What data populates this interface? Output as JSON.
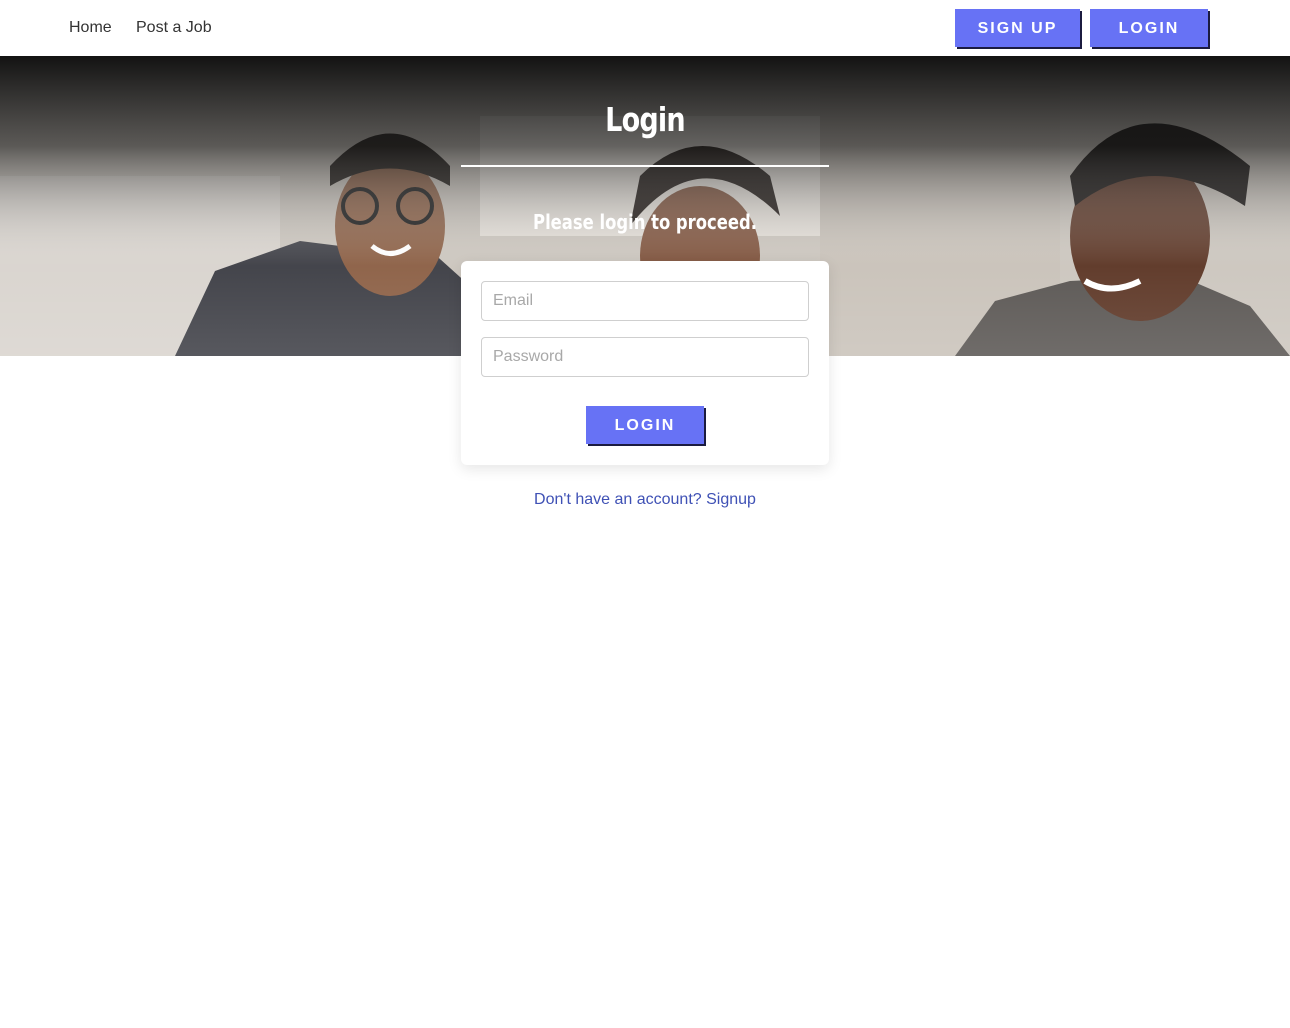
{
  "nav": {
    "home": "Home",
    "post_job": "Post a Job",
    "signup_button": "SIGN UP",
    "login_button": "LOGIN"
  },
  "hero": {
    "title": "Login",
    "subtitle": "Please login to proceed."
  },
  "form": {
    "email_placeholder": "Email",
    "password_placeholder": "Password",
    "submit_label": "LOGIN"
  },
  "footer_link": "Don't have an account? Signup",
  "colors": {
    "accent": "#6772f5",
    "link": "#3f51b5"
  }
}
